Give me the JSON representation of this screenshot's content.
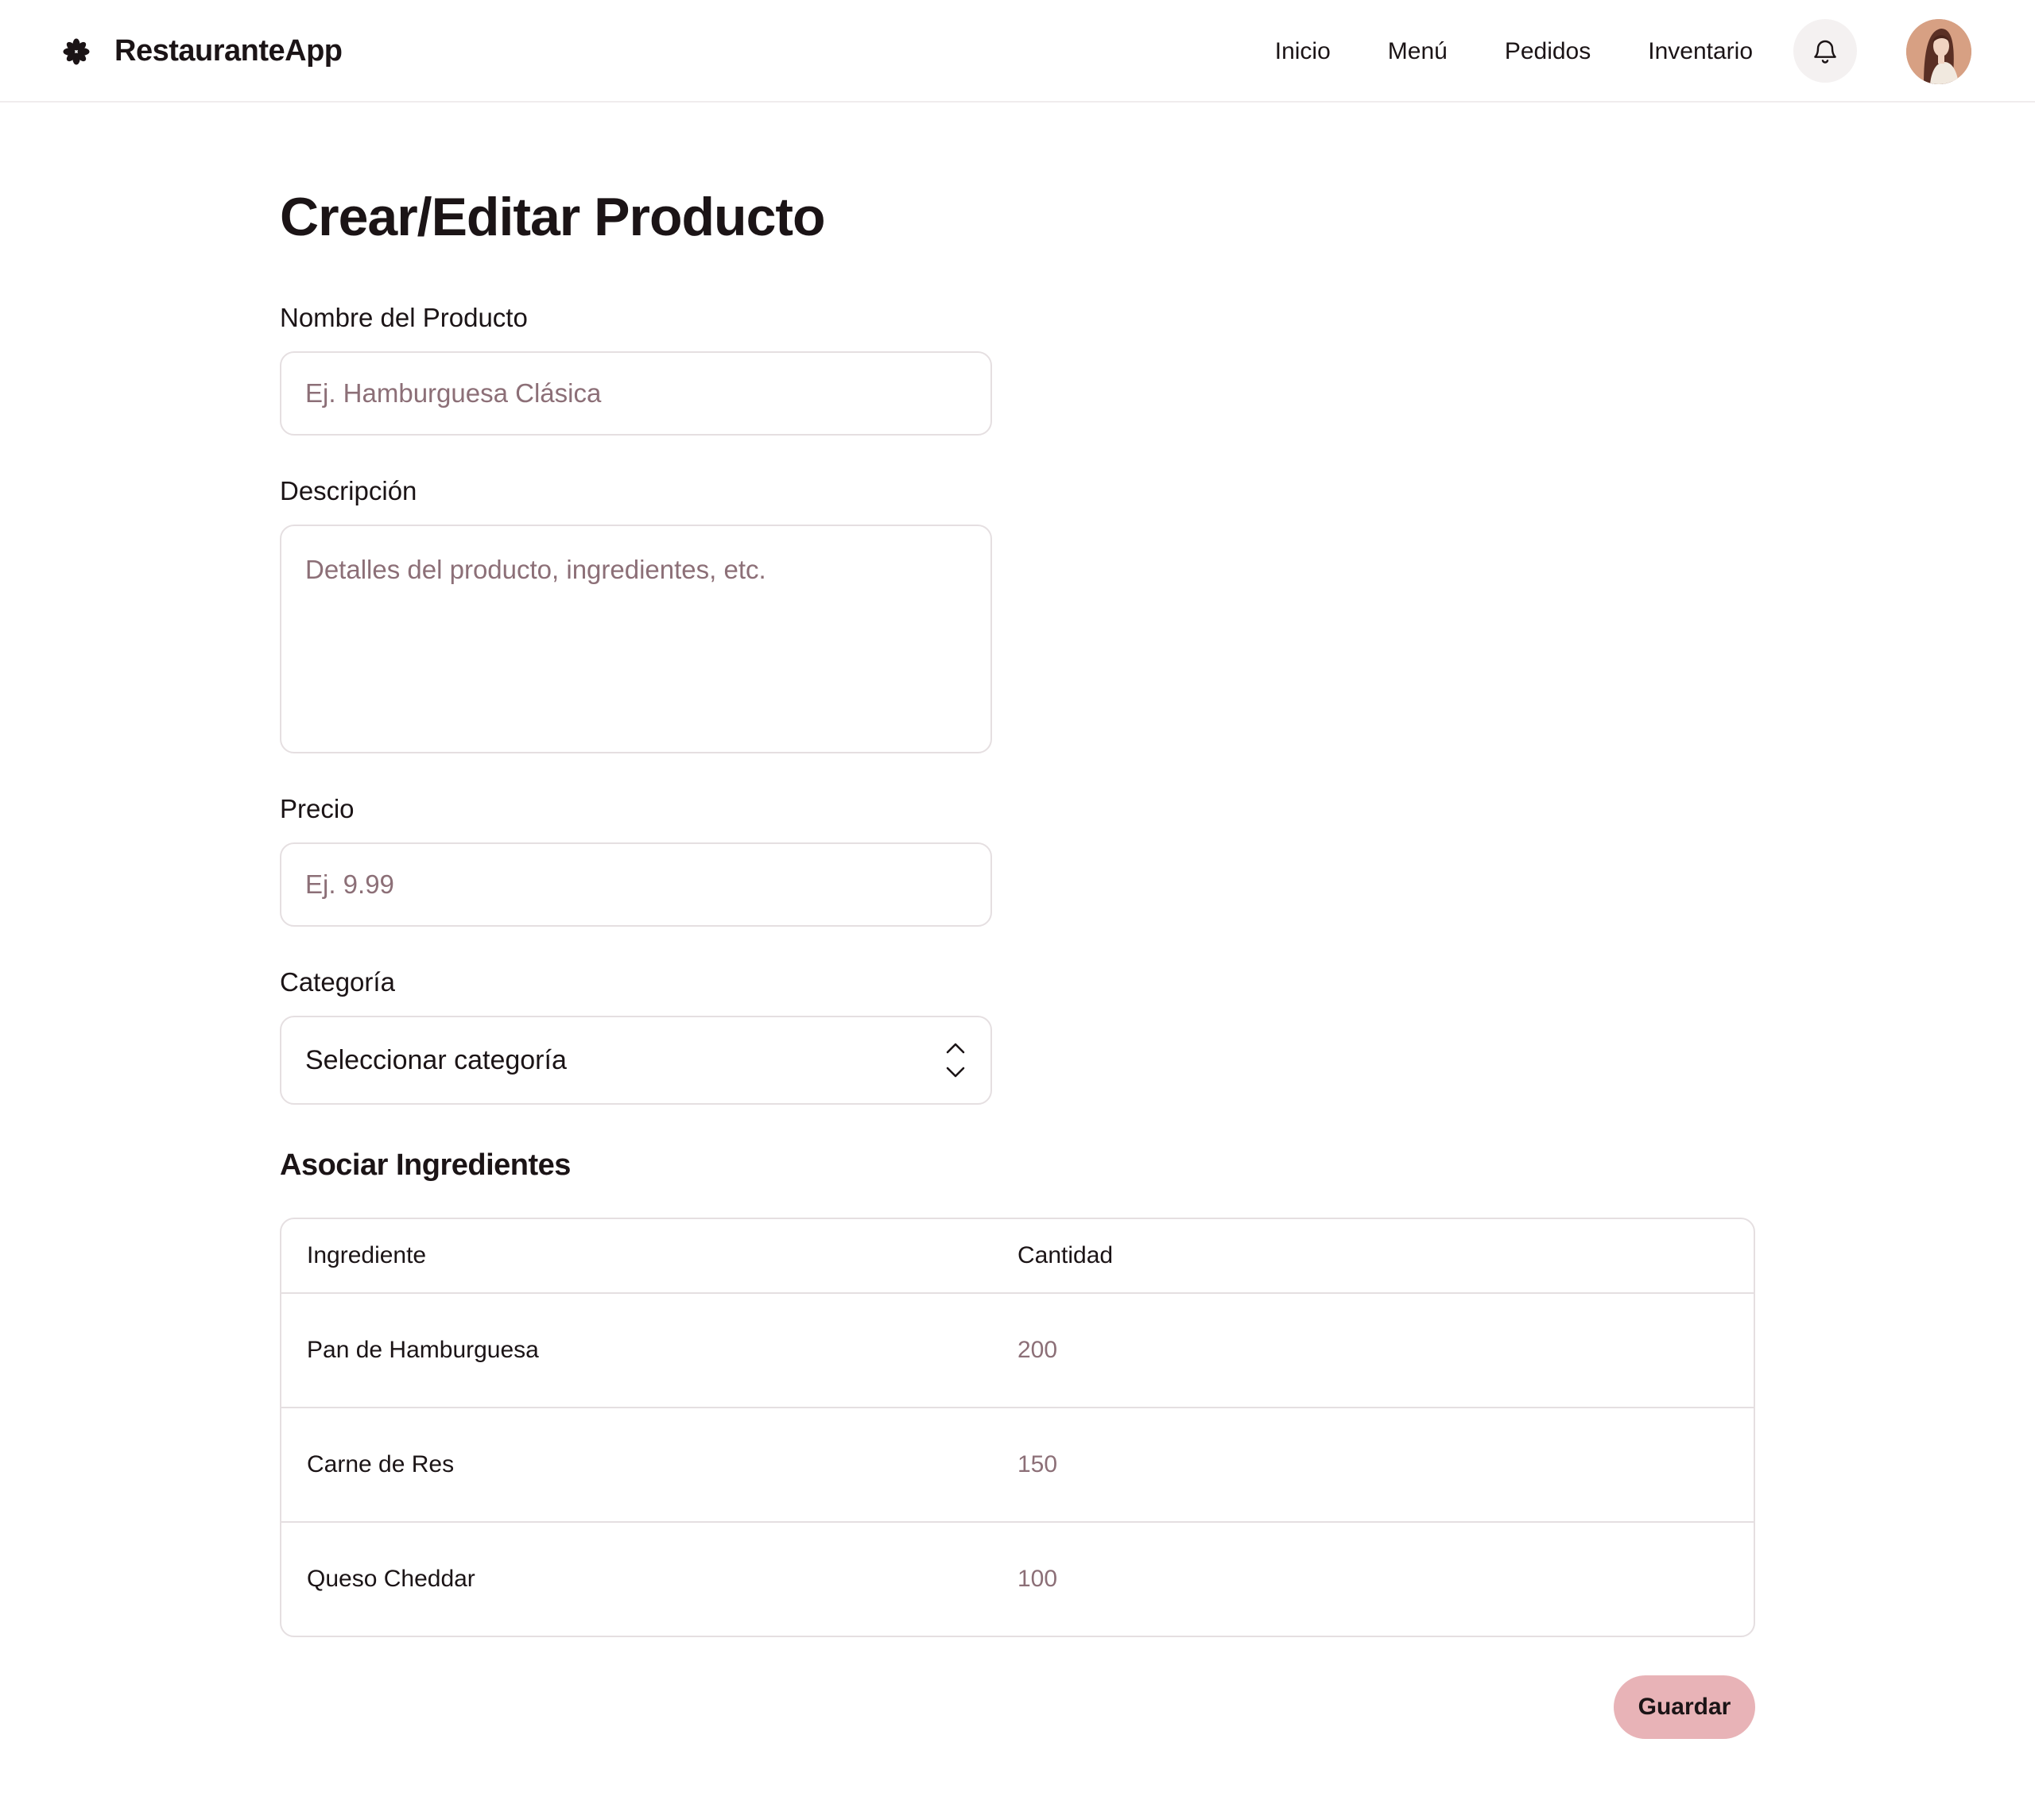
{
  "header": {
    "brand_name": "RestauranteApp",
    "logo_icon": "asterisk-flower-icon",
    "nav": [
      {
        "label": "Inicio"
      },
      {
        "label": "Menú"
      },
      {
        "label": "Pedidos"
      },
      {
        "label": "Inventario"
      }
    ],
    "notification_icon": "bell-icon",
    "avatar_icon": "user-avatar"
  },
  "main": {
    "title": "Crear/Editar Producto",
    "fields": {
      "name": {
        "label": "Nombre del Producto",
        "placeholder": "Ej. Hamburguesa Clásica",
        "value": ""
      },
      "description": {
        "label": "Descripción",
        "placeholder": "Detalles del producto, ingredientes, etc.",
        "value": ""
      },
      "price": {
        "label": "Precio",
        "placeholder": "Ej. 9.99",
        "value": ""
      },
      "category": {
        "label": "Categoría",
        "selected": "Seleccionar categoría",
        "icon": "chevron-up-down-icon"
      }
    },
    "ingredients_section": {
      "title": "Asociar Ingredientes",
      "columns": {
        "ingredient": "Ingrediente",
        "quantity": "Cantidad"
      },
      "rows": [
        {
          "ingredient": "Pan de Hamburguesa",
          "quantity": "200"
        },
        {
          "ingredient": "Carne de Res",
          "quantity": "150"
        },
        {
          "ingredient": "Queso Cheddar",
          "quantity": "100"
        }
      ]
    },
    "save_label": "Guardar"
  },
  "colors": {
    "text": "#1b1416",
    "muted": "#8c6f77",
    "border": "#e5dfe1",
    "accent": "#e8b3b7",
    "icon_bg": "#f4f1f1"
  }
}
